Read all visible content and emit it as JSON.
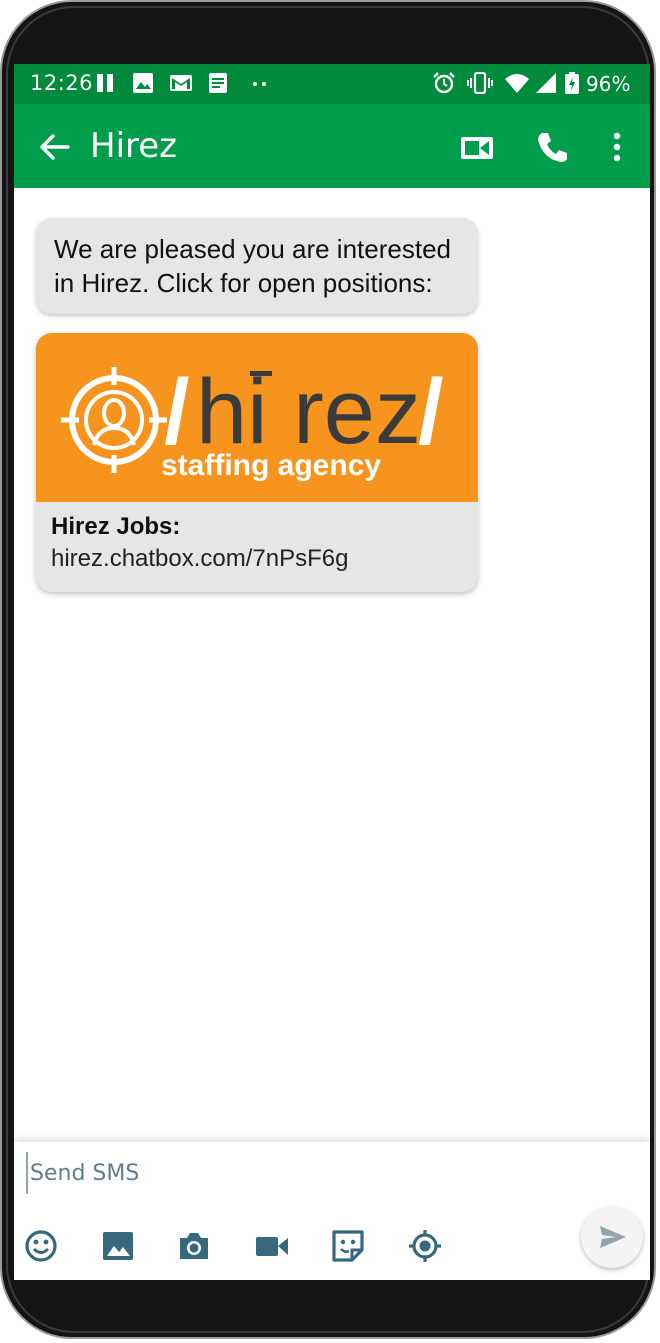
{
  "status_bar": {
    "time": "12:26",
    "battery_percent": "96%"
  },
  "app_bar": {
    "title": "Hirez"
  },
  "messages": {
    "text": "We are pleased you are interested in Hirez. Click for open positions:",
    "link_card": {
      "logo_text": "/hi rez/",
      "logo_tagline": "staffing agency",
      "title": "Hirez Jobs:",
      "url": "hirez.chatbox.com/7nPsF6g"
    }
  },
  "composer": {
    "placeholder": "Send SMS"
  },
  "colors": {
    "status_bar": "#008a3b",
    "app_bar": "#009e4c",
    "card_banner": "#f7941d",
    "bubble": "#e6e6e6",
    "toolbar_icons": "#37687e"
  },
  "icons": {
    "status": [
      "pause-icon",
      "image-icon",
      "gmail-icon",
      "document-icon",
      "more-dots-icon",
      "alarm-icon",
      "vibrate-icon",
      "wifi-icon",
      "cell-signal-icon",
      "battery-charging-icon"
    ],
    "app_bar": [
      "back-arrow-icon",
      "video-call-icon",
      "phone-icon",
      "more-vert-icon"
    ],
    "composer": [
      "emoji-icon",
      "gallery-icon",
      "camera-icon",
      "video-icon",
      "sticker-icon",
      "location-icon",
      "send-icon"
    ]
  }
}
